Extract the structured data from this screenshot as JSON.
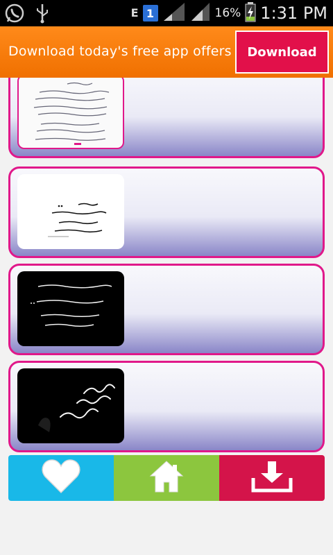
{
  "status_bar": {
    "network_type": "E",
    "sim_number": "1",
    "battery": "16%",
    "time": "1:31 PM",
    "icons": [
      "whatsapp-icon",
      "usb-icon",
      "signal-icon",
      "battery-charging-icon"
    ]
  },
  "ad": {
    "text": "Download today's free app offers",
    "button_label": "Download"
  },
  "list": {
    "items": [
      {
        "thumbnail": "quote-image-1",
        "style": "light-handwritten"
      },
      {
        "thumbnail": "quote-image-2",
        "style": "white-text"
      },
      {
        "thumbnail": "quote-image-3",
        "style": "black-text"
      },
      {
        "thumbnail": "quote-image-4",
        "style": "black-calligraphy"
      }
    ]
  },
  "bottom_nav": {
    "items": [
      {
        "icon": "heart-icon",
        "color": "#19b8e8"
      },
      {
        "icon": "home-icon",
        "color": "#8cc63e"
      },
      {
        "icon": "download-icon",
        "color": "#d4144a"
      }
    ]
  },
  "colors": {
    "accent": "#e0188a",
    "ad_background": "#f07000",
    "ad_button": "#e2104a"
  }
}
